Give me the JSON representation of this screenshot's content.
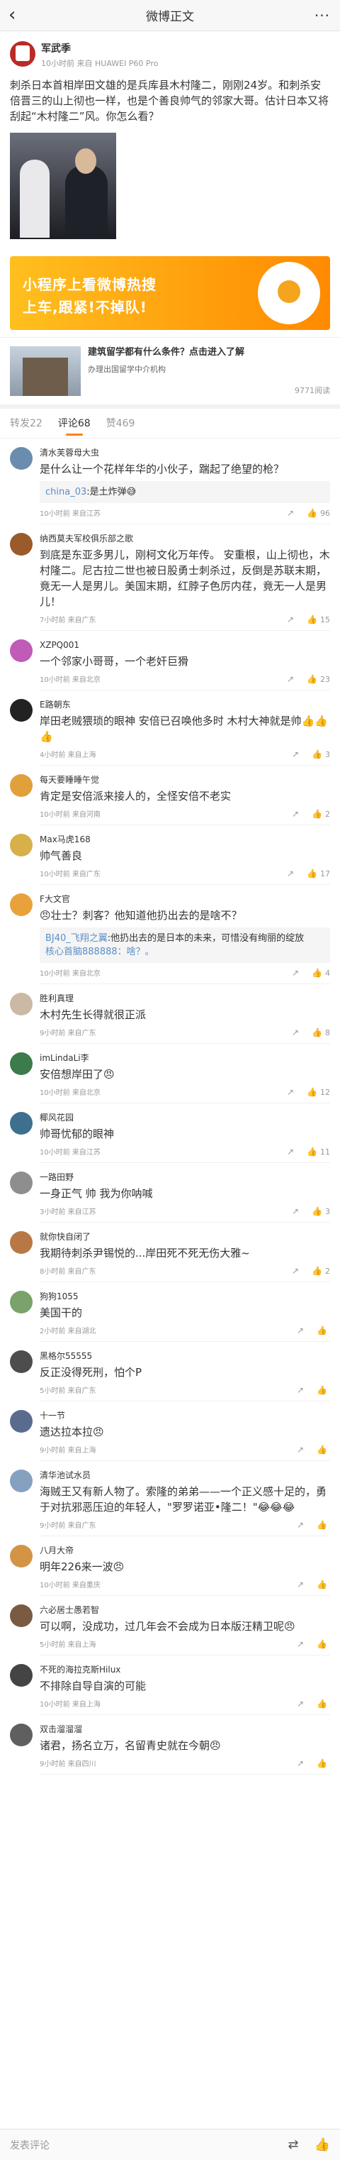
{
  "nav": {
    "title": "微博正文",
    "back_icon": "chevron-left-icon",
    "more_icon": "more-dots-icon"
  },
  "post": {
    "author": "军武季",
    "meta": "10小时前 来自 HUAWEI P60 Pro",
    "text": "刺杀日本首相岸田文雄的是兵库县木村隆二，刚刚24岁。和刺杀安倍晋三的山上彻也一样，也是个善良帅气的邻家大哥。估计日本又将刮起“木村隆二”风。你怎么看？"
  },
  "banner": {
    "line1": "小程序上看微博热搜",
    "line2": "上车,跟紧!不掉队!"
  },
  "ad": {
    "title": "建筑留学都有什么条件？点击进入了解",
    "sub": "办理出国留学中介机构",
    "reads": "9771阅读"
  },
  "tabs": [
    {
      "label": "转发22"
    },
    {
      "label": "评论68"
    },
    {
      "label": "赞469"
    }
  ],
  "comments": [
    {
      "name": "清水芙蓉母大虫",
      "text": "是什么让一个花样年华的小伙子，踹起了绝望的枪？",
      "reply_name": "china_03",
      "reply_text": ":是土炸弹😅",
      "meta": "10小时前 来自江苏",
      "likes": "96",
      "color": "#6a8caf"
    },
    {
      "name": "纳西莫夫军校俱乐部之歌",
      "text": "到底是东亚多男儿，刚柯文化万年传。 安重根，山上彻也，木村隆二。尼古拉二世也被日股勇士刺杀过，反倒是苏联末期，竟无一人是男儿。美国末期，红脖子色厉内荏，竟无一人是男儿！",
      "meta": "7小时前 来自广东",
      "likes": "15",
      "color": "#9b5a2a"
    },
    {
      "name": "XZPQ001",
      "text": "一个邻家小哥哥，一个老奸巨猾",
      "meta": "10小时前 来自北京",
      "likes": "23",
      "color": "#c05bb8"
    },
    {
      "name": "E路朝东",
      "text": "岸田老贼猥琐的眼神 安倍已召唤他多时 木村大神就是帅👍👍👍",
      "meta": "4小时前 来自上海",
      "likes": "3",
      "color": "#222"
    },
    {
      "name": "每天要睡睡午觉",
      "text": "肯定是安倍派来接人的，全怪安倍不老实",
      "meta": "10小时前 来自河南",
      "likes": "2",
      "color": "#e0a03a"
    },
    {
      "name": "Max马虎168",
      "text": "帅气善良",
      "meta": "10小时前 来自广东",
      "likes": "17",
      "color": "#d7b04a"
    },
    {
      "name": "F大文官",
      "text": "😠壮士？刺客？他知道他扔出去的是啥不？",
      "reply_name": "BJ40_飞翔之翼",
      "reply_text": ":他扔出去的是日本的未来，可惜没有绚丽的绽放",
      "reply2": "核心首脑888888：啥？。",
      "meta": "10小时前 来自北京",
      "likes": "4",
      "color": "#e9a23b"
    },
    {
      "name": "胜利真理",
      "text": "木村先生长得就很正派",
      "meta": "9小时前 来自广东",
      "likes": "8",
      "color": "#cbb9a5"
    },
    {
      "name": "imLindaLi李",
      "text": "安倍想岸田了😠",
      "meta": "10小时前 来自北京",
      "likes": "12",
      "color": "#3c7b4a"
    },
    {
      "name": "椰风花园",
      "text": "帅哥忧郁的眼神",
      "meta": "10小时前 来自江苏",
      "likes": "11",
      "color": "#3e6f8e"
    },
    {
      "name": "一路田野",
      "text": "一身正气 帅 我为你呐喊",
      "meta": "3小时前 来自江苏",
      "likes": "3",
      "color": "#8e8e8e"
    },
    {
      "name": "就你快自闭了",
      "text": "我期待刺杀尹锡悦的...岸田死不死无伤大雅~",
      "meta": "8小时前 来自广东",
      "likes": "2",
      "color": "#b87845"
    },
    {
      "name": "狗狗1055",
      "text": "美国干的",
      "meta": "2小时前 来自湖北",
      "likes": "",
      "color": "#7aa26a"
    },
    {
      "name": "黑格尔55555",
      "text": "反正没得死刑，怕个P",
      "meta": "5小时前 来自广东",
      "likes": "",
      "color": "#4d4d4d"
    },
    {
      "name": "十一节",
      "text": "遗达拉本拉😠",
      "meta": "9小时前 来自上海",
      "likes": "",
      "color": "#5a6c8e"
    },
    {
      "name": "清华池试水员",
      "text": "海贼王又有新人物了。索隆的弟弟——一个正义感十足的，勇于对抗邪恶压迫的年轻人，\"罗罗诺亚•隆二！\"😂😂😂",
      "meta": "9小时前 来自广东",
      "likes": "",
      "color": "#86a0bf"
    },
    {
      "name": "八月大帝",
      "text": "明年226来一波😠",
      "meta": "10小时前 来自重庆",
      "likes": "",
      "color": "#d39545"
    },
    {
      "name": "六必居士愚若智",
      "text": "可以啊，没成功，过几年会不会成为日本版汪精卫呢😠",
      "meta": "5小时前 来自上海",
      "likes": "",
      "color": "#7a5b42"
    },
    {
      "name": "不死的海拉克斯Hilux",
      "text": "不排除自导自演的可能",
      "meta": "10小时前 来自上海",
      "likes": "",
      "color": "#444"
    },
    {
      "name": "双击溜溜溜",
      "text": "诸君，扬名立万，名留青史就在今朝😠",
      "meta": "9小时前 来自四川",
      "likes": "",
      "color": "#5f5f5f"
    }
  ],
  "bottom": {
    "placeholder": "发表评论",
    "icon1": "repost-icon",
    "icon2": "like-icon"
  }
}
